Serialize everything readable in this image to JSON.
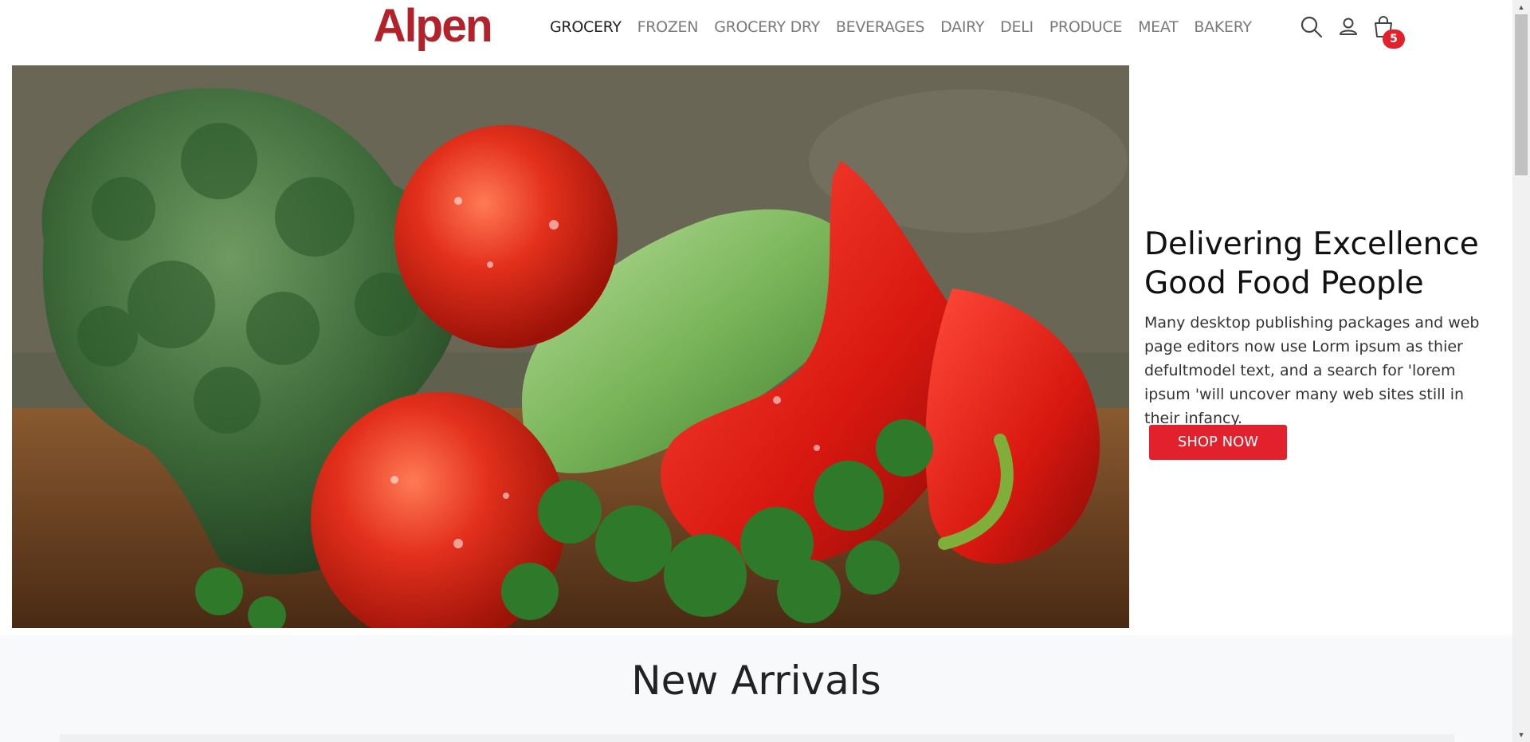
{
  "brand": {
    "logo_text": "Alpen",
    "logo_color": "#b3222a",
    "accent_color": "#e3212d"
  },
  "nav": {
    "items": [
      {
        "label": "GROCERY",
        "active": true
      },
      {
        "label": "FROZEN",
        "active": false
      },
      {
        "label": "GROCERY DRY",
        "active": false
      },
      {
        "label": "BEVERAGES",
        "active": false
      },
      {
        "label": "DAIRY",
        "active": false
      },
      {
        "label": "DELI",
        "active": false
      },
      {
        "label": "PRODUCE",
        "active": false
      },
      {
        "label": "MEAT",
        "active": false
      },
      {
        "label": "BAKERY",
        "active": false
      }
    ]
  },
  "header_icons": {
    "search": "search-icon",
    "account": "user-icon",
    "cart": "shopping-bag-icon",
    "cart_count": "5"
  },
  "hero": {
    "image": "vegetables-photo",
    "title_line1": "Delivering Excellence",
    "title_line2": "Good Food People",
    "description": "Many desktop publishing packages and web page editors now use Lorm ipsum as thier defultmodel text, and a search for 'lorem ipsum 'will uncover many web sites still in their infancy.",
    "cta_label": "SHOP NOW"
  },
  "section": {
    "title": "New Arrivals"
  }
}
